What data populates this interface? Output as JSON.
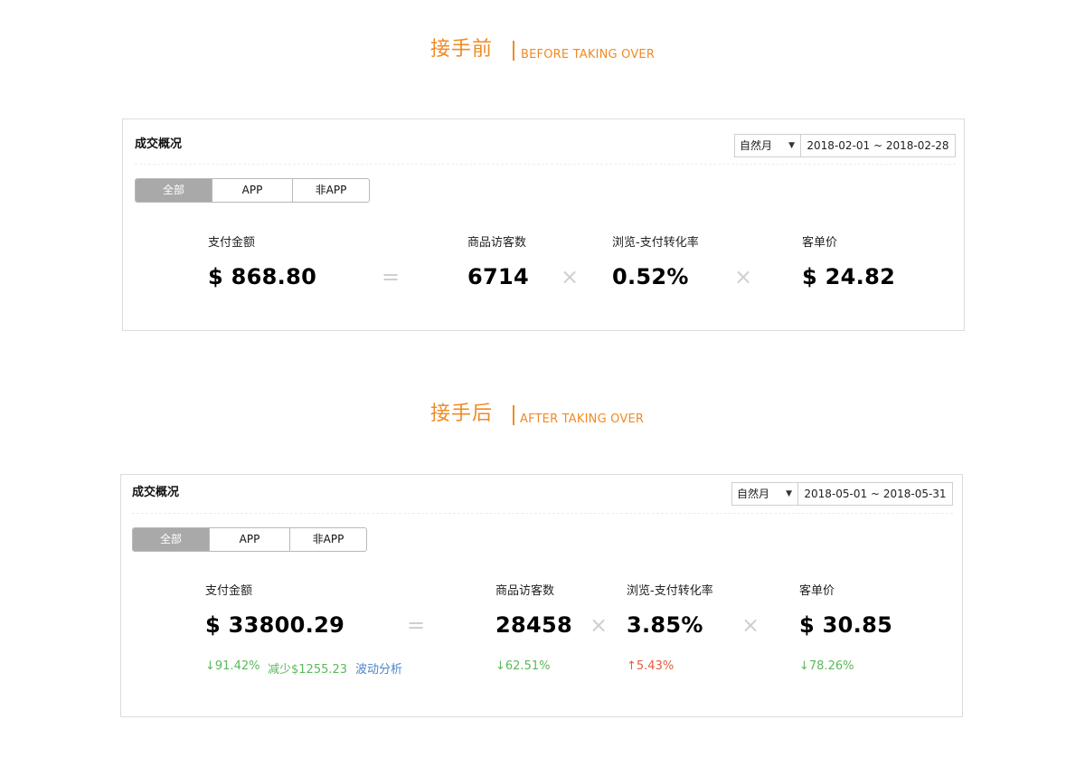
{
  "before": {
    "title_cn": "接手前",
    "title_en": "BEFORE TAKING OVER",
    "panel": {
      "title": "成交概况",
      "period_select": "自然月",
      "date_range": "2018-02-01 ~ 2018-02-28",
      "tabs": [
        {
          "label": "全部",
          "active": true
        },
        {
          "label": "APP",
          "active": false
        },
        {
          "label": "非APP",
          "active": false
        }
      ],
      "metrics": [
        {
          "label": "支付金额",
          "value": "$ 868.80"
        },
        {
          "label": "商品访客数",
          "value": "6714"
        },
        {
          "label": "浏览-支付转化率",
          "value": "0.52%"
        },
        {
          "label": "客单价",
          "value": "$ 24.82"
        }
      ],
      "operators": [
        "=",
        "×",
        "×"
      ]
    }
  },
  "after": {
    "title_cn": "接手后",
    "title_en": "AFTER TAKING OVER",
    "panel": {
      "title": "成交概况",
      "period_select": "自然月",
      "date_range": "2018-05-01 ~ 2018-05-31",
      "tabs": [
        {
          "label": "全部",
          "active": true
        },
        {
          "label": "APP",
          "active": false
        },
        {
          "label": "非APP",
          "active": false
        }
      ],
      "metrics": [
        {
          "label": "支付金额",
          "value": "$ 33800.29",
          "delta": "↓91.42%",
          "extra": "减少$1255.23",
          "link": "波动分析"
        },
        {
          "label": "商品访客数",
          "value": "28458",
          "delta": "↓62.51%"
        },
        {
          "label": "浏览-支付转化率",
          "value": "3.85%",
          "delta": "↑5.43%"
        },
        {
          "label": "客单价",
          "value": "$ 30.85",
          "delta": "↓78.26%"
        }
      ],
      "operators": [
        "=",
        "×",
        "×"
      ]
    }
  },
  "colors": {
    "accent": "#f08a24",
    "down": "#5cb85c",
    "up": "#e45b3a",
    "link": "#4b86c8",
    "tab_active": "#a9a9a9"
  }
}
